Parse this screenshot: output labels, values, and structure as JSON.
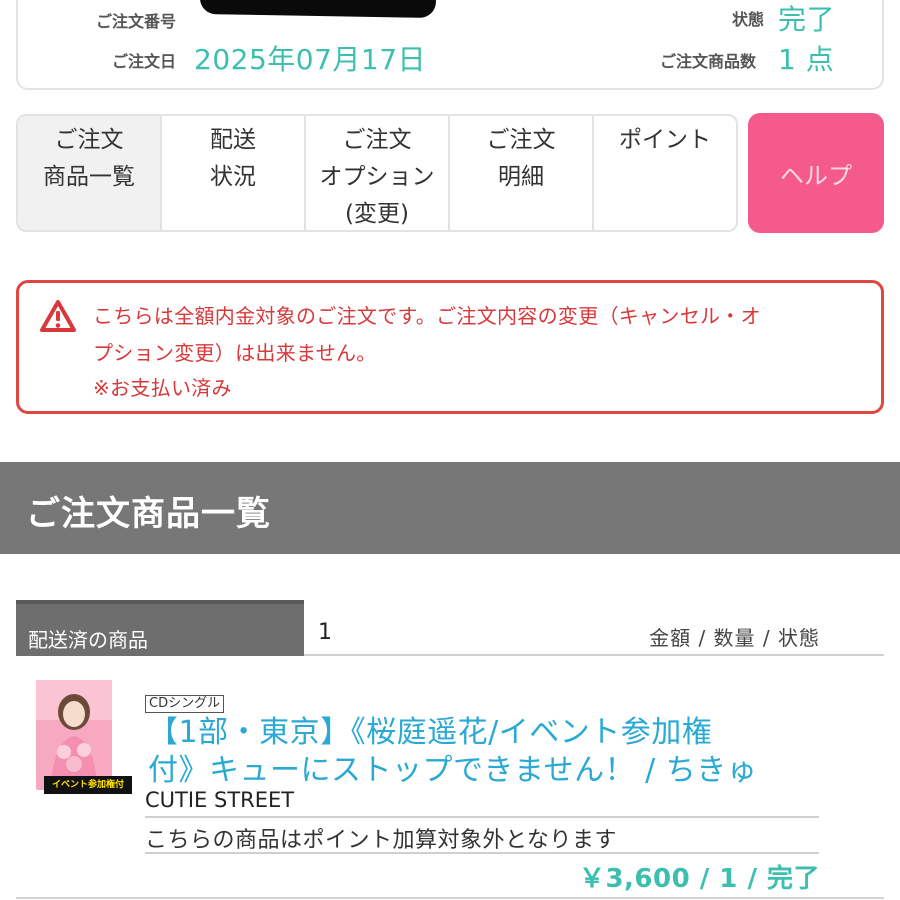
{
  "order": {
    "number_label": "ご注文番号",
    "status_label": "状態",
    "status_value": "完了",
    "date_label": "ご注文日",
    "date_value": "2025年07月17日",
    "item_count_label": "ご注文商品数",
    "item_count_value": "1 点"
  },
  "tabs": [
    {
      "line1": "ご注文",
      "line2": "商品一覧",
      "line3": ""
    },
    {
      "line1": "配送",
      "line2": "状況",
      "line3": ""
    },
    {
      "line1": "ご注文",
      "line2": "オプション",
      "line3": "(変更)"
    },
    {
      "line1": "ご注文",
      "line2": "明細",
      "line3": ""
    },
    {
      "line1": "ポイント",
      "line2": "",
      "line3": ""
    }
  ],
  "help_label": "ヘルプ",
  "alert": {
    "line1": "こちらは全額内金対象のご注文です。ご注文内容の変更（キャンセル・オ",
    "line2": "プション変更）は出来ません。",
    "line3": "※お支払い済み"
  },
  "section_title": "ご注文商品一覧",
  "shipped": {
    "tab_label": "配送済の商品",
    "count": "1",
    "column_headers": "金額 / 数量 / 状態"
  },
  "product": {
    "badge": "イベント参加権付",
    "category": "CDシングル",
    "title_line1": "【1部・東京】《桜庭遥花/イベント参加権",
    "title_line2": "付》キューにストップできません！ / ちきゅ",
    "artist": "CUTIE STREET",
    "note": "こちらの商品はポイント加算対象外となります",
    "price_line": "￥3,600 / 1 / 完了"
  },
  "colors": {
    "accent_teal": "#3cbfae",
    "help_pink": "#f45a8b",
    "alert_red": "#e0453f",
    "link_blue": "#29a9d4",
    "header_gray": "#777777"
  }
}
